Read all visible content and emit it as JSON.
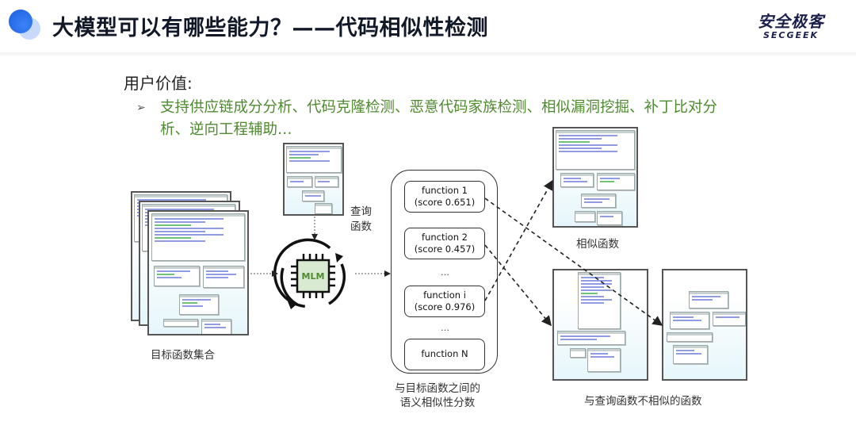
{
  "header": {
    "title": "大模型可以有哪些能力？——代码相似性检测",
    "logo_cn": "安全极客",
    "logo_en": "SECGEEK",
    "accent_color": "#2563eb"
  },
  "user_value": {
    "label": "用户价值:",
    "bullet_text": "支持供应链成分分析、代码克隆检测、恶意代码家族检测、相似漏洞挖掘、补丁比对分析、逆向工程辅助…",
    "bullet_color": "#4e8a2e"
  },
  "diagram": {
    "target_set_label": "目标函数集合",
    "query_label_line1": "查询",
    "query_label_line2": "函数",
    "model_label": "MLM",
    "scores_label_line1": "与目标函数之间的",
    "scores_label_line2": "语义相似性分数",
    "functions": [
      {
        "name": "function 1",
        "score": "(score 0.651)"
      },
      {
        "name": "function 2",
        "score": "(score 0.457)"
      },
      {
        "name": "function i",
        "score": "(score 0.976)"
      },
      {
        "name": "function N",
        "score": ""
      }
    ],
    "ellipsis": "…",
    "similar_label": "相似函数",
    "dissimilar_label": "与查询函数不相似的函数",
    "edges": [
      {
        "from": "function 1",
        "to": "dissimilar-function-b"
      },
      {
        "from": "function 2",
        "to": "dissimilar-function-a"
      },
      {
        "from": "function i",
        "to": "similar-function"
      }
    ]
  }
}
